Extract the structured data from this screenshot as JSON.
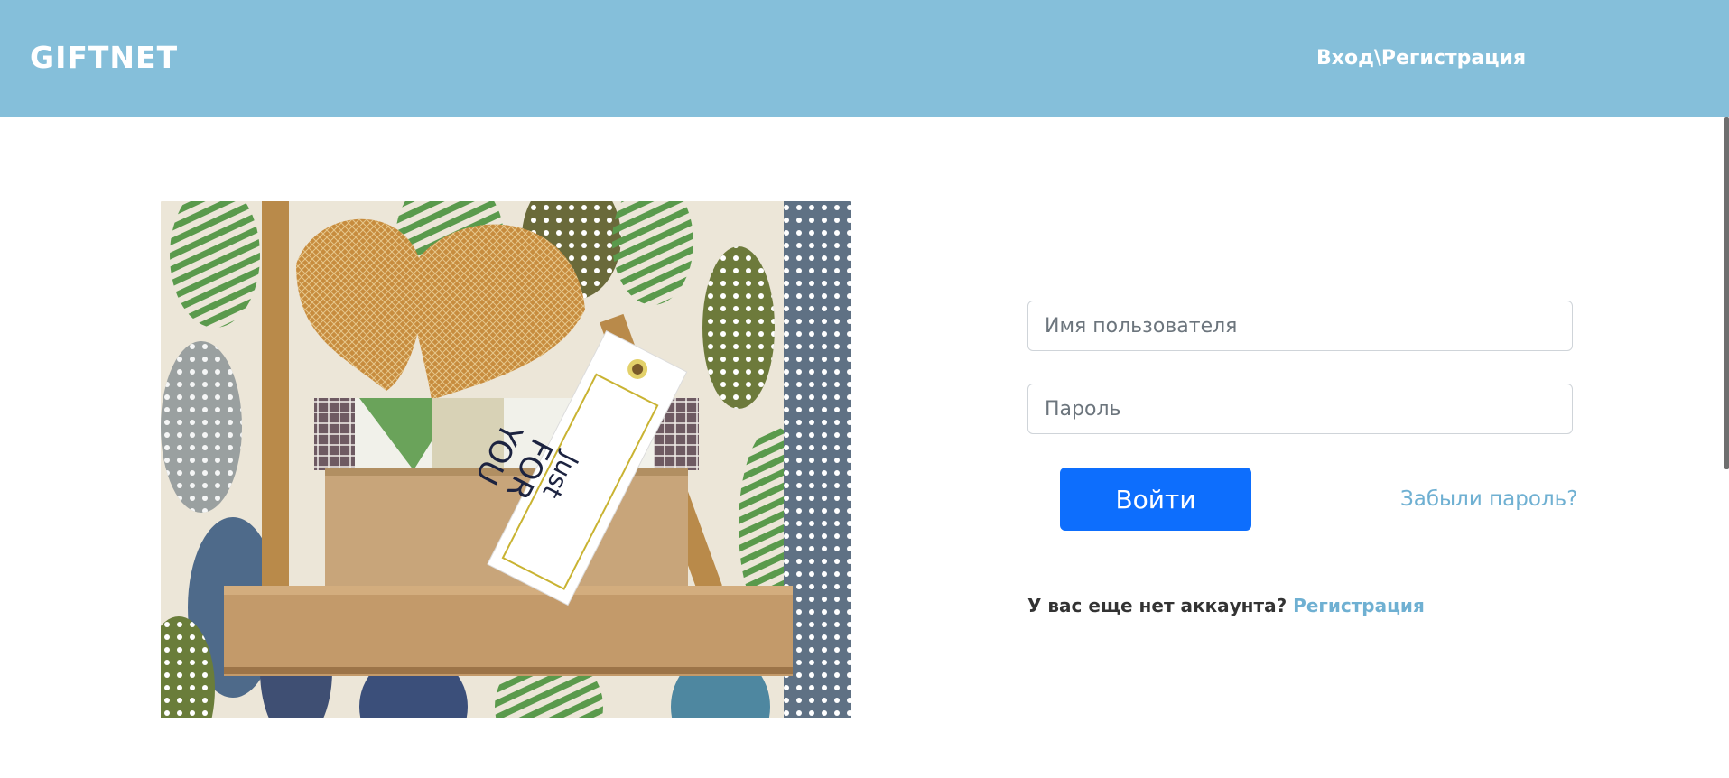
{
  "header": {
    "logo": "GIFTNET",
    "auth_link": "Вход\\Регистрация"
  },
  "hero": {
    "tag_text_line1": "Just",
    "tag_text_line2": "FOR",
    "tag_text_line3": "YOU"
  },
  "form": {
    "username_placeholder": "Имя пользователя",
    "password_placeholder": "Пароль",
    "login_label": "Войти",
    "forgot_label": "Забыли пароль?",
    "no_account_text": "У вас еще нет аккаунта?",
    "register_label": "Регистрация"
  },
  "colors": {
    "header_bg": "#85bfda",
    "primary_button": "#0d6efd",
    "link": "#6fb0d2"
  }
}
